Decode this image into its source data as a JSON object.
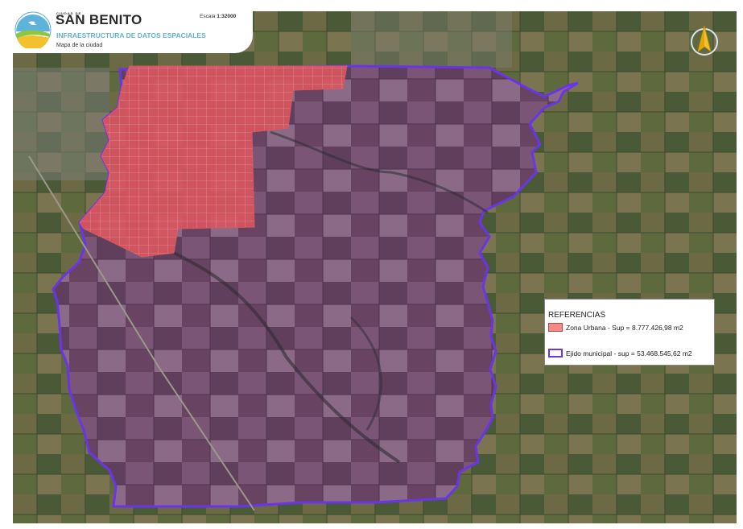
{
  "header": {
    "org_small": "CIUDAD DE",
    "org_name": "SAN BENITO",
    "section": "INFRAESTRUCTURA DE DATOS ESPACIALES",
    "subtitle": "Mapa de la ciudad",
    "scale_label": "Escala",
    "scale_value": "1:32000"
  },
  "legend": {
    "title": "REFERENCIAS",
    "items": [
      {
        "label": "Zona Urbana - Sup = 8.777.426,98 m2",
        "color": "#f28a85"
      },
      {
        "label": "Ejido municipal - sup = 53.468.545,62 m2",
        "color": "#6a35e8"
      }
    ]
  },
  "icons": {
    "logo": "city-logo-icon",
    "north": "north-arrow-icon"
  }
}
